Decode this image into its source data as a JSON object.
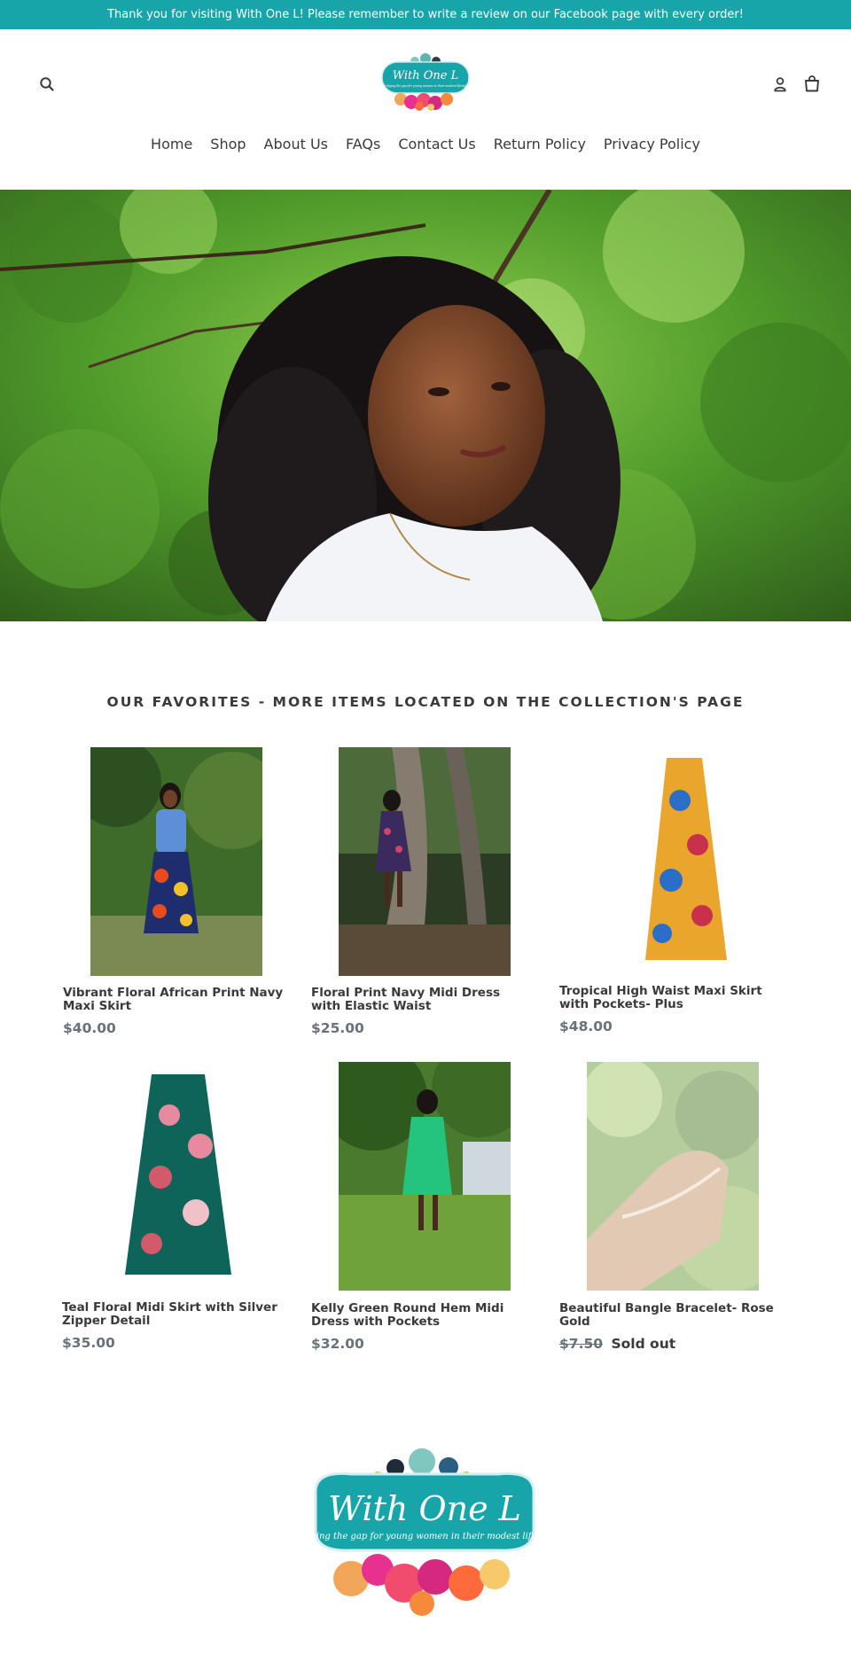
{
  "announcement": "Thank you for visiting With One L! Please remember to write a review on our Facebook page with every order!",
  "header": {
    "search_icon": "search-icon",
    "account_icon": "user-icon",
    "cart_icon": "cart-icon",
    "logo_small": {
      "brand": "With One L",
      "tagline": "Bridging the gap for young women in their modest lifestyle"
    }
  },
  "nav": [
    "Home",
    "Shop",
    "About Us",
    "FAQs",
    "Contact Us",
    "Return Policy",
    "Privacy Policy"
  ],
  "section_title": "OUR FAVORITES - MORE ITEMS LOCATED ON THE COLLECTION'S PAGE",
  "products": [
    {
      "title": "Vibrant Floral African Print Navy Maxi Skirt",
      "price": "$40.00"
    },
    {
      "title": "Floral Print Navy Midi Dress with Elastic Waist",
      "price": "$25.00"
    },
    {
      "title": "Tropical High Waist Maxi Skirt with Pockets- Plus",
      "price": "$48.00"
    },
    {
      "title": "Teal Floral Midi Skirt with Silver Zipper Detail",
      "price": "$35.00"
    },
    {
      "title": "Kelly Green Round Hem Midi Dress with Pockets",
      "price": "$32.00"
    },
    {
      "title": "Beautiful Bangle Bracelet- Rose Gold",
      "price": "$7.50",
      "status": "Sold out"
    }
  ],
  "footer_logo": {
    "brand": "With One L",
    "tagline": "Bridging the gap for young women in their modest lifestyle"
  },
  "colors": {
    "accent": "#17a5a9",
    "text": "#3a3a3a",
    "price": "#69727b"
  }
}
